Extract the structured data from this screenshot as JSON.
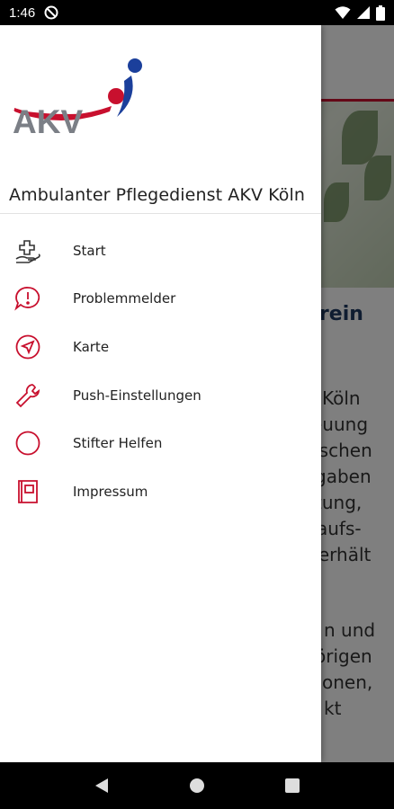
{
  "status_bar": {
    "time": "1:46",
    "icons": [
      "do-not-disturb-icon",
      "wifi-icon",
      "signal-icon",
      "battery-icon"
    ]
  },
  "background": {
    "heading": "erein",
    "lines": [
      "Köln",
      "euung",
      "nschen",
      "gaben",
      "tung,",
      "aufs-",
      "terhält",
      "n und",
      "örigen",
      "onen,",
      "kt"
    ]
  },
  "drawer": {
    "title": "Ambulanter Pflegedienst AKV Köln",
    "logo_text": "AKV",
    "items": [
      {
        "label": "Start",
        "icon": "caring-hand-icon"
      },
      {
        "label": "Problemmelder",
        "icon": "alert-bubble-icon"
      },
      {
        "label": "Karte",
        "icon": "navigation-icon"
      },
      {
        "label": "Push-Einstellungen",
        "icon": "wrench-icon"
      },
      {
        "label": "Stifter Helfen",
        "icon": "circle-icon"
      },
      {
        "label": "Impressum",
        "icon": "book-icon"
      }
    ]
  },
  "colors": {
    "accent_red": "#c8102e",
    "logo_blue": "#1b3f9b",
    "logo_grey": "#7b7f86"
  },
  "nav_bar": {
    "buttons": [
      "back-icon",
      "home-icon",
      "recents-icon"
    ]
  }
}
